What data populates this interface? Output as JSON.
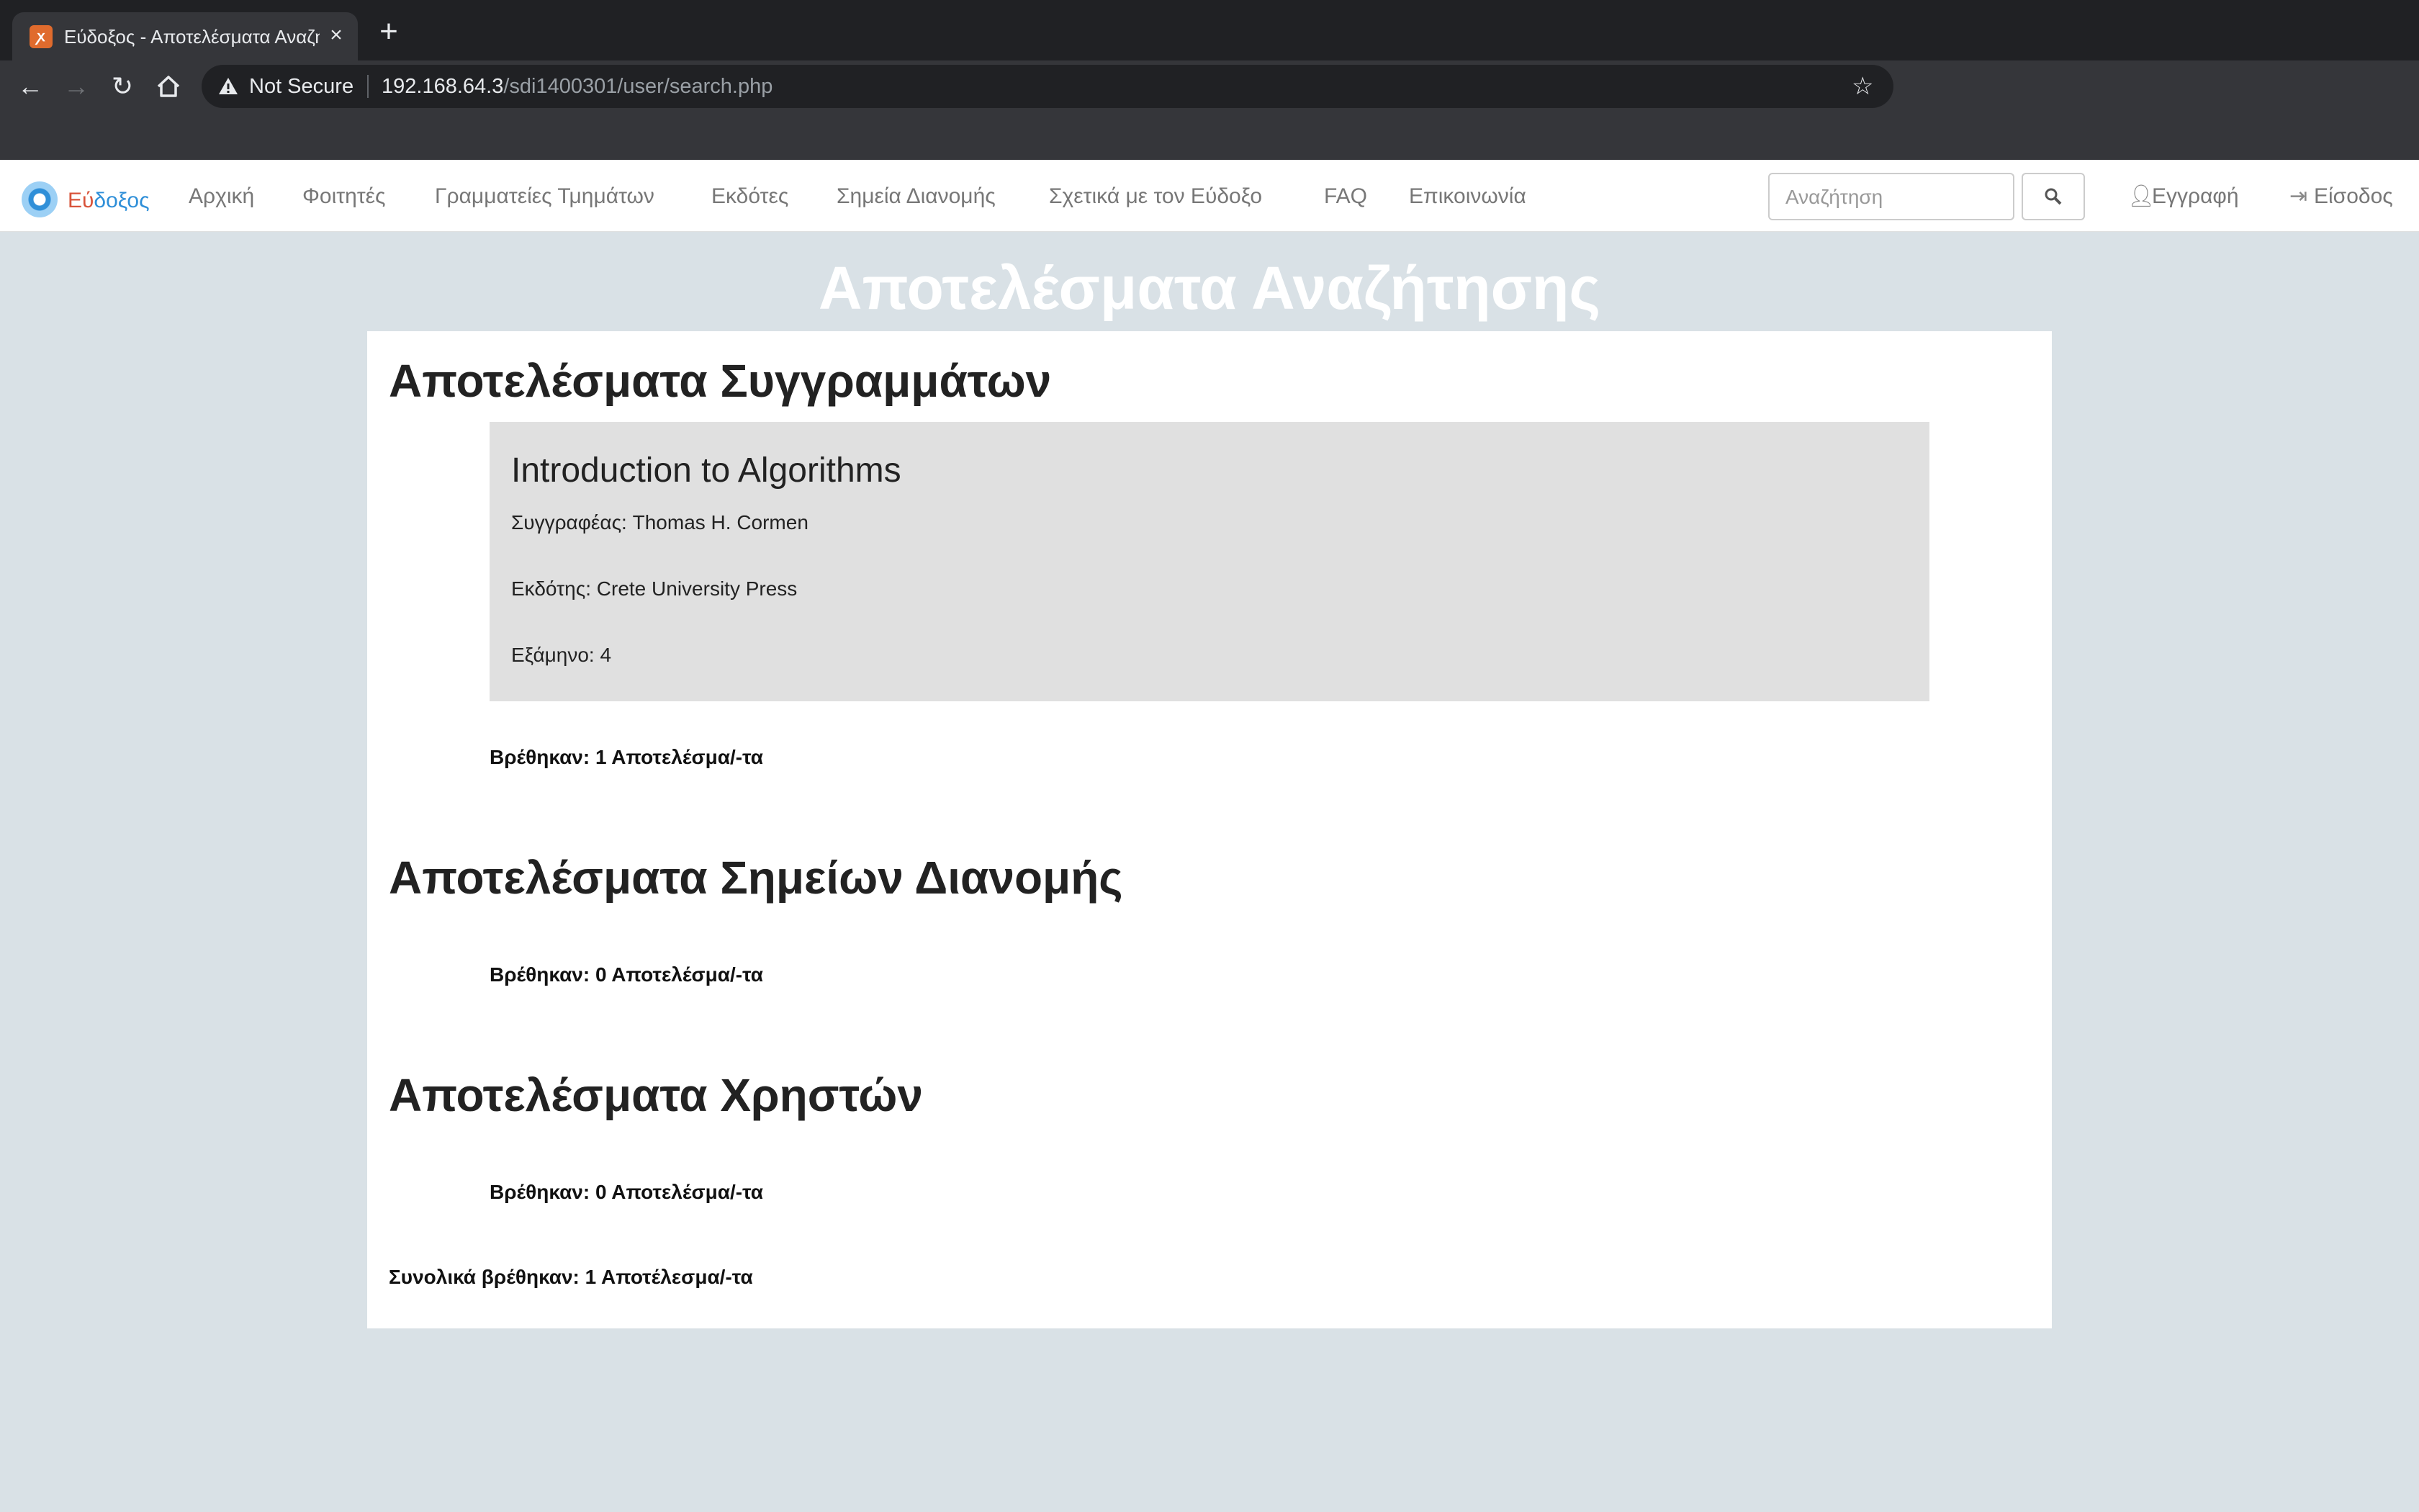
{
  "browser": {
    "tab": {
      "title": "Εύδοξος - Αποτελέσματα Αναζήτησης",
      "close_icon": "×"
    },
    "new_tab_icon": "+",
    "omnibox": {
      "security_label": "Not Secure",
      "url_host": "192.168.64.3",
      "url_path": "/sdi1400301/user/search.php"
    }
  },
  "site": {
    "brand": {
      "part1": "Εύ",
      "part2": "δοξος"
    },
    "nav": [
      "Αρχική",
      "Φοιτητές",
      "Γραμματείες Τμημάτων",
      "Εκδότες",
      "Σημεία Διανομής",
      "Σχετικά με τον Εύδοξο",
      "FAQ",
      "Επικοινωνία"
    ],
    "search": {
      "placeholder": "Αναζήτηση"
    },
    "register_label": "Εγγραφή",
    "login_label": "Είσοδος"
  },
  "page": {
    "title": "Αποτελέσματα Αναζήτησης",
    "sections": {
      "books": {
        "title": "Αποτελέσματα Συγγραμμάτων",
        "items": [
          {
            "title": "Introduction to Algorithms",
            "author": "Συγγραφέας: Thomas H. Cormen",
            "publisher": "Εκδότης: Crete University Press",
            "semester": "Εξάμηνο: 4"
          }
        ],
        "count": "Βρέθηκαν: 1 Αποτελέσμα/-τα"
      },
      "points": {
        "title": "Αποτελέσματα Σημείων Διανομής",
        "count": "Βρέθηκαν: 0 Αποτελέσμα/-τα"
      },
      "users": {
        "title": "Αποτελέσματα Χρηστών",
        "count": "Βρέθηκαν: 0 Αποτελέσμα/-τα"
      }
    },
    "total": "Συνολικά βρέθηκαν: 1 Αποτέλεσμα/-τα"
  }
}
